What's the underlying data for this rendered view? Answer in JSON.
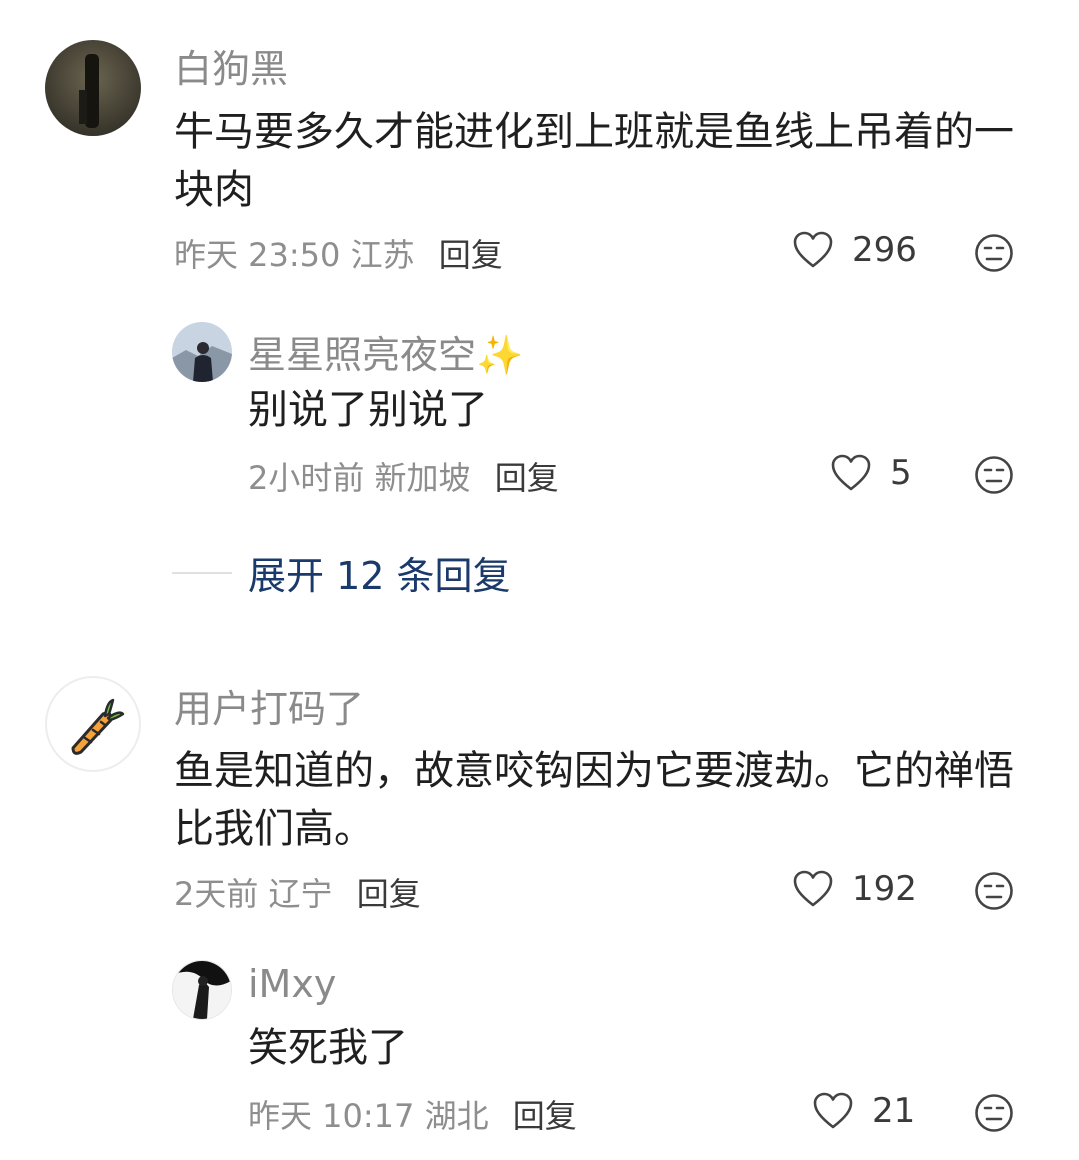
{
  "comments": [
    {
      "user": "白狗黑",
      "text": "牛马要多久才能进化到上班就是鱼线上吊着的一块肉",
      "time": "昨天 23:50",
      "location": "江苏",
      "reply_label": "回复",
      "likes": "296",
      "replies": [
        {
          "user": "星星照亮夜空✨",
          "text": "别说了别说了",
          "time": "2小时前",
          "location": "新加坡",
          "reply_label": "回复",
          "likes": "5"
        }
      ],
      "expand_label": "展开 12 条回复"
    },
    {
      "user": "用户打码了",
      "text": "鱼是知道的，故意咬钩因为它要渡劫。它的禅悟比我们高。",
      "time": "2天前",
      "location": "辽宁",
      "reply_label": "回复",
      "likes": "192",
      "replies": [
        {
          "user": "iMxy",
          "text": "笑死我了",
          "time": "昨天 10:17",
          "location": "湖北",
          "reply_label": "回复",
          "likes": "21"
        }
      ]
    }
  ],
  "colors": {
    "text": "#1f1f1f",
    "username": "#8a8a8a",
    "meta": "#8e8e8e",
    "expand": "#1a3a6b"
  },
  "icons": [
    "heart-outline-icon",
    "dislike-face-icon",
    "carrot-icon"
  ]
}
